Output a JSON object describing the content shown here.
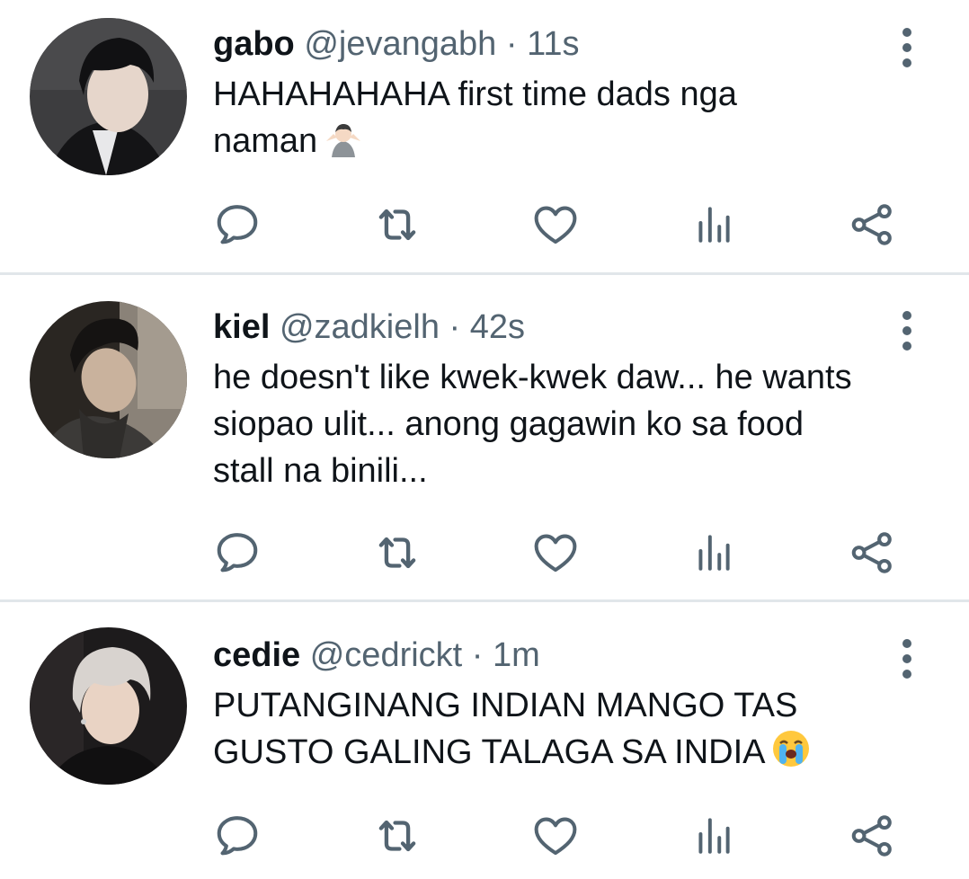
{
  "colors": {
    "text": "#0f1419",
    "secondary": "#536471",
    "icon": "#536471",
    "divider": "#e1e6ea"
  },
  "tweets": [
    {
      "name": "gabo",
      "handle": "@jevangabh",
      "separator": "·",
      "time": "11s",
      "lines": [
        "HAHAHAHAHA first time dads nga",
        "naman"
      ],
      "emoji": "person-shrugging-emoji"
    },
    {
      "name": "kiel",
      "handle": "@zadkielh",
      "separator": "·",
      "time": "42s",
      "lines": [
        "he doesn't like kwek-kwek daw... he wants",
        "siopao ulit... anong gagawin ko sa food",
        "stall na binili..."
      ]
    },
    {
      "name": "cedie",
      "handle": "@cedrickt",
      "separator": "·",
      "time": "1m",
      "lines": [
        "PUTANGINANG INDIAN MANGO TAS",
        "GUSTO GALING TALAGA SA INDIA"
      ],
      "emoji": "loudly-crying-face-emoji"
    }
  ],
  "action_icons": [
    "reply-icon",
    "retweet-icon",
    "like-icon",
    "views-icon",
    "share-icon"
  ],
  "more_icon": "more-options-icon"
}
